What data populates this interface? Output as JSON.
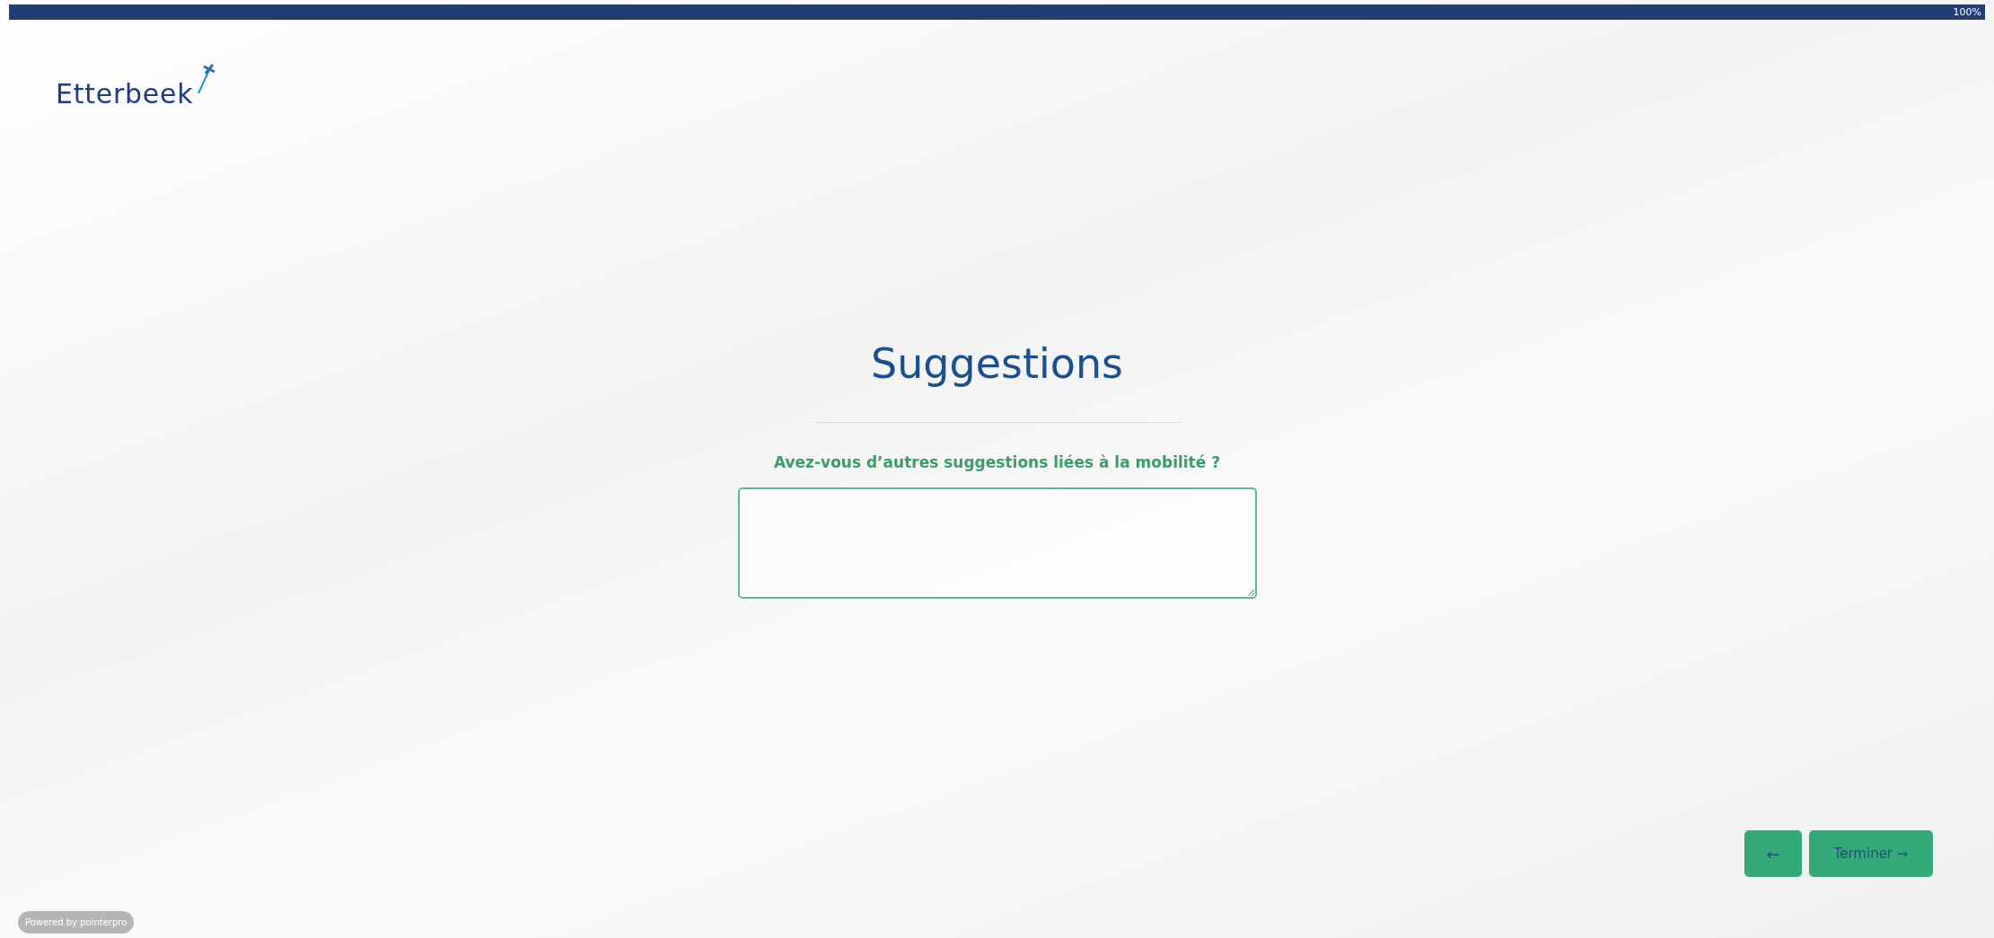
{
  "progress": {
    "level": 1,
    "reading": "100%"
  },
  "logo": {
    "text": "Etterbeek"
  },
  "title": "Suggestions",
  "question": {
    "label": "Avez-vous d’autres suggestions liées à la mobilité ?"
  },
  "buttons": [
    {
      "kind": "back",
      "label": "←"
    },
    {
      "kind": "finish",
      "label": "Terminer →"
    }
  ],
  "footer_badge": "Powered by pointerpro"
}
